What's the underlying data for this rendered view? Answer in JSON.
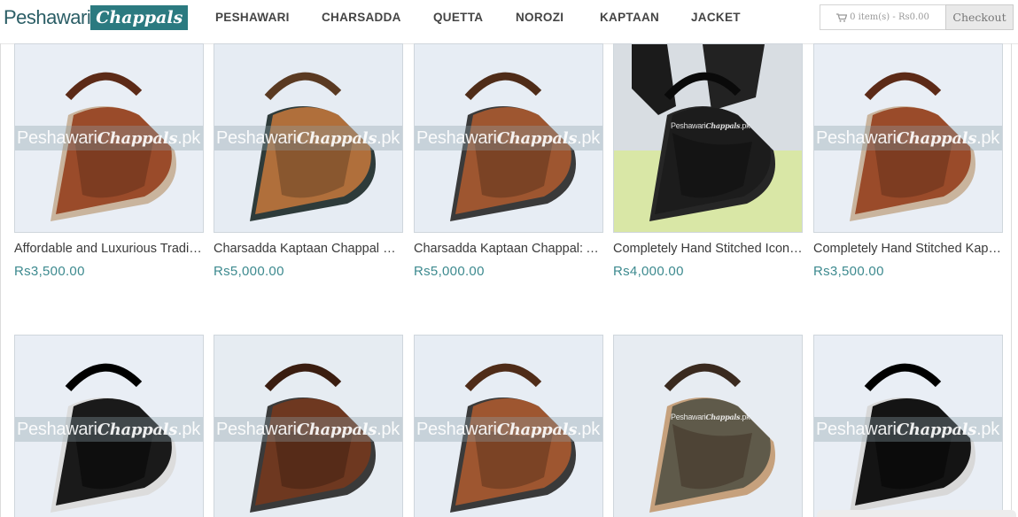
{
  "brand": {
    "part1": "Peshawari",
    "part2": "Chappals",
    "accent": "#2b7a80"
  },
  "nav": [
    {
      "label": "PESHAWARI"
    },
    {
      "label": "CHARSADDA"
    },
    {
      "label": "QUETTA"
    },
    {
      "label": "NOROZI"
    },
    {
      "label": "KAPTAAN"
    },
    {
      "label": "JACKET"
    }
  ],
  "cart": {
    "summary": "0 item(s) - Rs0.00",
    "icon": "cart-icon",
    "checkout_label": "Checkout"
  },
  "watermark": {
    "a": "Peshawari",
    "b": "Chappals",
    "c": ".pk"
  },
  "products": [
    {
      "title": "Affordable and Luxurious Traditional Peshawari Chappal",
      "price": "Rs3,500.00",
      "style": "brown-kaptaan"
    },
    {
      "title": "Charsadda Kaptaan Chappal with Tan Leather",
      "price": "Rs5,000.00",
      "style": "tan-charsadda"
    },
    {
      "title": "Charsadda Kaptaan Chappal: A Masterpiece",
      "price": "Rs5,000.00",
      "style": "brown-charsadda"
    },
    {
      "title": "Completely Hand Stitched Iconic Black Chappal",
      "price": "Rs4,000.00",
      "style": "black-worn"
    },
    {
      "title": "Completely Hand Stitched Kaptaan Chappal",
      "price": "Rs3,500.00",
      "style": "brown-kaptaan"
    },
    {
      "title": "",
      "price": "",
      "style": "black-norozi"
    },
    {
      "title": "",
      "price": "",
      "style": "brown-pair"
    },
    {
      "title": "",
      "price": "",
      "style": "brown-charsadda"
    },
    {
      "title": "",
      "price": "",
      "style": "olive-pair"
    },
    {
      "title": "",
      "price": "",
      "style": "black-pair"
    }
  ]
}
